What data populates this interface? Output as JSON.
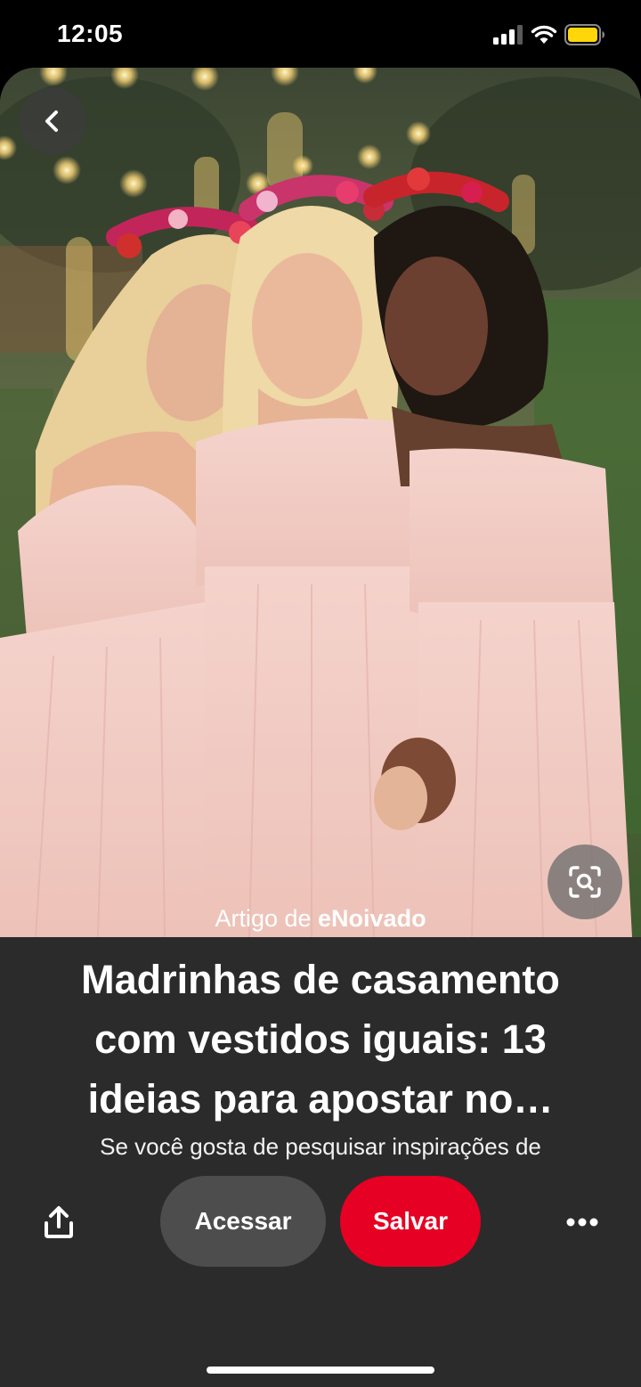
{
  "status_bar": {
    "time": "12:05",
    "battery_color": "#ffd60a"
  },
  "pin": {
    "back_icon": "chevron-left-icon",
    "visual_search_icon": "visual-search-icon",
    "image_alt": "Three bridesmaids in matching blush pink off-shoulder dresses wearing flower crowns",
    "source_prefix": "Artigo de",
    "source_name": "eNoivado",
    "title": "Madrinhas de casamento com vestidos iguais: 13 ideias para apostar no…",
    "description": "Se você gosta de pesquisar inspirações de"
  },
  "actions": {
    "share_icon": "share-icon",
    "access_label": "Acessar",
    "save_label": "Salvar",
    "more_icon": "more-icon",
    "save_color": "#e60023"
  }
}
